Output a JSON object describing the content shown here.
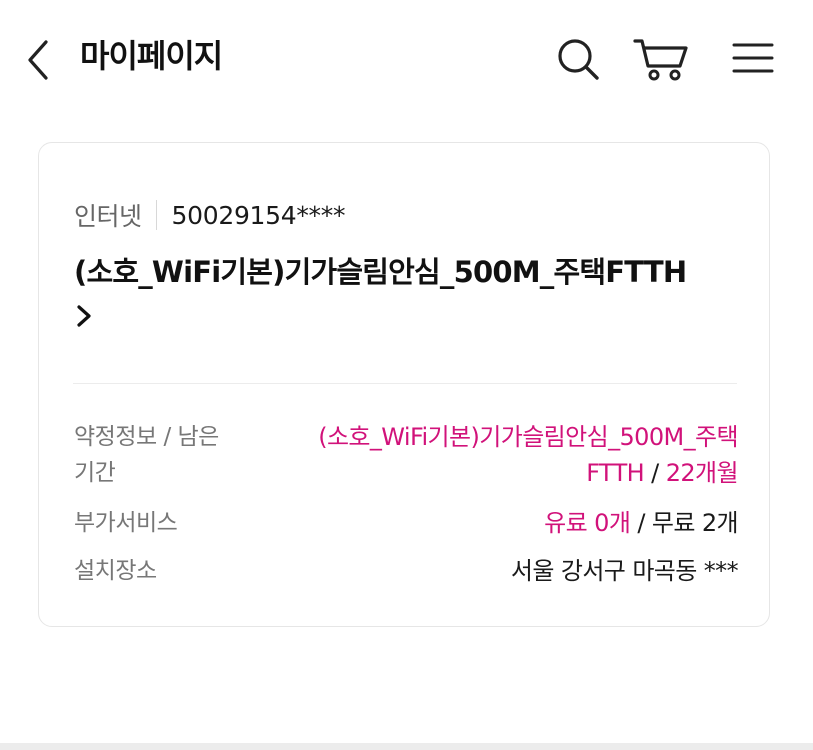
{
  "header": {
    "title": "마이페이지",
    "icons": {
      "back": "chevron-left-icon",
      "search": "search-icon",
      "cart": "cart-icon",
      "menu": "hamburger-menu-icon"
    }
  },
  "service": {
    "type": "인터넷",
    "number": "50029154****",
    "plan_name": "(소호_WiFi기본)기가슬림안심_500M_주택FTTH",
    "details": {
      "contract": {
        "label_line1": "약정정보 / 남은",
        "label_line2": "기간",
        "plan_line1": "(소호_WiFi기본)기가슬림안심_500M_주택",
        "plan_line2": "FTTH",
        "separator": "/",
        "remaining": "22개월"
      },
      "addon": {
        "label": "부가서비스",
        "paid": "유료 0개",
        "separator": "/",
        "free": "무료 2개"
      },
      "location": {
        "label": "설치장소",
        "value": "서울 강서구 마곡동 ***"
      }
    }
  },
  "colors": {
    "accent": "#d1127a",
    "text": "#1a1a1a",
    "muted": "#777777",
    "border": "#e6e6e6"
  }
}
